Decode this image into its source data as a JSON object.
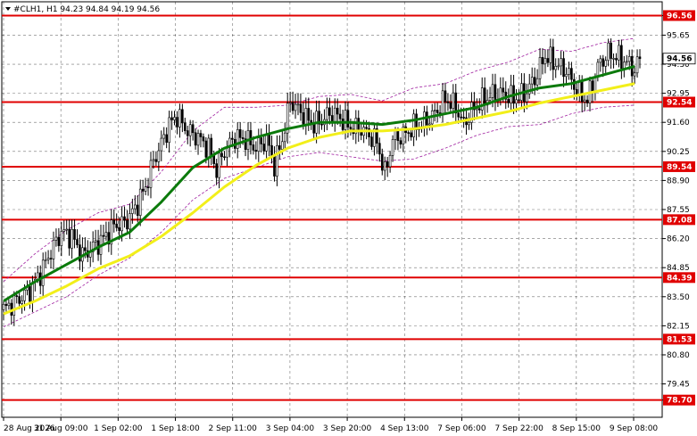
{
  "header": {
    "title": "#CLH1, H1  94.23 94.84 94.19 94.56"
  },
  "colors": {
    "background": "#ffffff",
    "candle": "#000000",
    "level": "#e00000",
    "ma_fast": "#0b7a0b",
    "ma_slow": "#f2ef1a",
    "envelope": "#a020a0",
    "grid": "#000000"
  },
  "current_price": {
    "value": 94.56,
    "label": "94.56"
  },
  "chart_data": {
    "type": "candlestick",
    "title": "#CLH1, H1  94.23 94.84 94.19 94.56",
    "symbol": "#CLH1",
    "timeframe": "H1",
    "ylim": [
      77.9,
      97.2
    ],
    "grid": "dashed",
    "y_ticks": [
      "96.56",
      "95.65",
      "94.30",
      "92.95",
      "91.60",
      "90.25",
      "88.90",
      "87.55",
      "86.20",
      "84.85",
      "83.50",
      "82.15",
      "80.80",
      "79.45",
      "78.70"
    ],
    "x_ticks": [
      "28 Aug 2026",
      "31 Aug 09:00",
      "1 Sep 02:00",
      "1 Sep 18:00",
      "2 Sep 11:00",
      "3 Sep 04:00",
      "3 Sep 20:00",
      "4 Sep 13:00",
      "7 Sep 06:00",
      "7 Sep 22:00",
      "8 Sep 15:00",
      "9 Sep 08:00"
    ],
    "levels": [
      {
        "value": 96.56,
        "label": "96.56"
      },
      {
        "value": 92.54,
        "label": "92.54"
      },
      {
        "value": 89.54,
        "label": "89.54"
      },
      {
        "value": 87.08,
        "label": "87.08"
      },
      {
        "value": 84.39,
        "label": "84.39"
      },
      {
        "value": 81.53,
        "label": "81.53"
      },
      {
        "value": 78.7,
        "label": "78.70"
      }
    ],
    "close_path": [
      [
        0,
        82.9
      ],
      [
        6,
        83.4
      ],
      [
        10,
        83.8
      ],
      [
        14,
        84.6
      ],
      [
        18,
        85.6
      ],
      [
        22,
        86.5
      ],
      [
        26,
        86.3
      ],
      [
        30,
        85.4
      ],
      [
        34,
        85.8
      ],
      [
        38,
        86.2
      ],
      [
        42,
        86.8
      ],
      [
        46,
        86.9
      ],
      [
        50,
        87.6
      ],
      [
        54,
        88.6
      ],
      [
        57,
        89.8
      ],
      [
        60,
        90.6
      ],
      [
        63,
        91.5
      ],
      [
        66,
        91.9
      ],
      [
        70,
        91.2
      ],
      [
        74,
        90.9
      ],
      [
        78,
        90.4
      ],
      [
        81,
        89.4
      ],
      [
        84,
        90.3
      ],
      [
        88,
        90.9
      ],
      [
        92,
        90.8
      ],
      [
        96,
        90.4
      ],
      [
        100,
        90.8
      ],
      [
        103,
        89.6
      ],
      [
        106,
        90.8
      ],
      [
        109,
        92.6
      ],
      [
        112,
        92.2
      ],
      [
        115,
        91.8
      ],
      [
        118,
        91.5
      ],
      [
        121,
        91.7
      ],
      [
        124,
        92.0
      ],
      [
        127,
        91.9
      ],
      [
        130,
        91.6
      ],
      [
        133,
        91.3
      ],
      [
        136,
        91.3
      ],
      [
        139,
        91.0
      ],
      [
        142,
        90.7
      ],
      [
        145,
        89.2
      ],
      [
        148,
        90.8
      ],
      [
        152,
        91.0
      ],
      [
        156,
        91.4
      ],
      [
        160,
        91.6
      ],
      [
        164,
        92.0
      ],
      [
        168,
        92.7
      ],
      [
        172,
        92.3
      ],
      [
        175,
        91.5
      ],
      [
        178,
        92.1
      ],
      [
        182,
        92.6
      ],
      [
        186,
        92.9
      ],
      [
        190,
        92.9
      ],
      [
        194,
        92.7
      ],
      [
        198,
        92.9
      ],
      [
        202,
        93.6
      ],
      [
        206,
        94.7
      ],
      [
        210,
        94.3
      ],
      [
        214,
        94.0
      ],
      [
        218,
        93.1
      ],
      [
        222,
        92.6
      ],
      [
        226,
        94.2
      ],
      [
        230,
        94.8
      ],
      [
        234,
        94.6
      ],
      [
        238,
        94.3
      ],
      [
        240,
        94.0
      ],
      [
        242,
        94.56
      ]
    ],
    "series": [
      {
        "name": "",
        "role": "moving average (fast)",
        "x": [
          0,
          12,
          24,
          36,
          48,
          60,
          72,
          84,
          96,
          108,
          120,
          132,
          144,
          156,
          168,
          180,
          192,
          204,
          216,
          228,
          240
        ],
        "values": [
          83.3,
          84.2,
          85.0,
          85.8,
          86.5,
          87.9,
          89.5,
          90.4,
          90.9,
          91.3,
          91.6,
          91.6,
          91.5,
          91.7,
          92.0,
          92.3,
          92.8,
          93.2,
          93.4,
          93.8,
          94.2
        ]
      },
      {
        "name": "",
        "role": "moving average (slow)",
        "x": [
          0,
          12,
          24,
          36,
          48,
          60,
          72,
          84,
          96,
          108,
          120,
          132,
          144,
          156,
          168,
          180,
          192,
          204,
          216,
          228,
          240
        ],
        "values": [
          82.7,
          83.3,
          84.0,
          84.8,
          85.4,
          86.3,
          87.4,
          88.6,
          89.6,
          90.4,
          90.9,
          91.2,
          91.2,
          91.3,
          91.5,
          91.8,
          92.1,
          92.5,
          92.8,
          93.1,
          93.4
        ]
      }
    ],
    "envelope": {
      "x": [
        0,
        12,
        24,
        36,
        48,
        60,
        72,
        84,
        96,
        108,
        120,
        132,
        144,
        156,
        168,
        180,
        192,
        204,
        216,
        228,
        240
      ],
      "upper": [
        84.2,
        85.5,
        86.6,
        87.4,
        87.8,
        89.3,
        91.2,
        92.3,
        92.3,
        92.4,
        92.8,
        92.9,
        92.6,
        93.2,
        93.4,
        94.0,
        94.4,
        95.0,
        94.9,
        95.3,
        95.5
      ],
      "lower": [
        82.1,
        82.8,
        83.5,
        84.5,
        85.3,
        86.5,
        88.0,
        89.0,
        89.5,
        90.0,
        90.2,
        90.0,
        89.8,
        89.9,
        90.4,
        91.0,
        91.4,
        91.5,
        92.0,
        92.3,
        92.4
      ]
    }
  }
}
